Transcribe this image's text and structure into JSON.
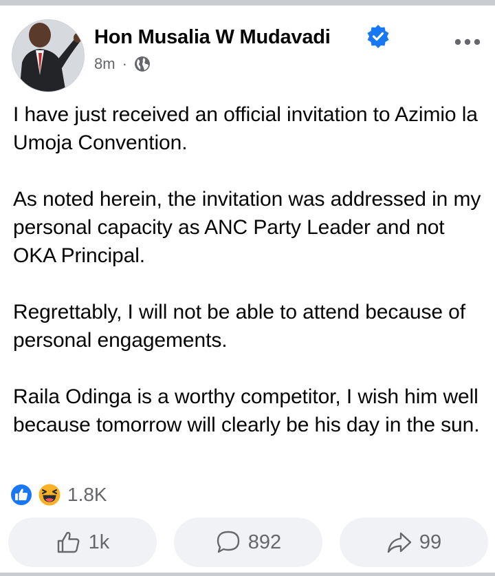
{
  "post": {
    "author": "Hon Musalia W Mudavadi",
    "verified": true,
    "time": "8m",
    "separator": "·",
    "audience_icon": "globe-icon",
    "paragraphs": [
      "I have just received an official invitation to Azimio la Umoja Convention.",
      "As noted herein, the invitation was addressed in my personal capacity as ANC Party Leader and not OKA Principal.",
      "Regrettably, I will not be able to attend because of personal engagements.",
      "Raila Odinga is a worthy competitor, I wish him well because tomorrow will clearly be his day in the sun."
    ]
  },
  "reactions": {
    "icons": [
      "like-reaction-icon",
      "haha-reaction-icon"
    ],
    "count": "1.8K"
  },
  "actions": {
    "like_count": "1k",
    "comment_count": "892",
    "share_count": "99"
  },
  "colors": {
    "verified_blue": "#1877f2",
    "secondary_text": "#65676b",
    "button_bg": "#f0f2f5",
    "haha_yellow": "#f7b125"
  }
}
